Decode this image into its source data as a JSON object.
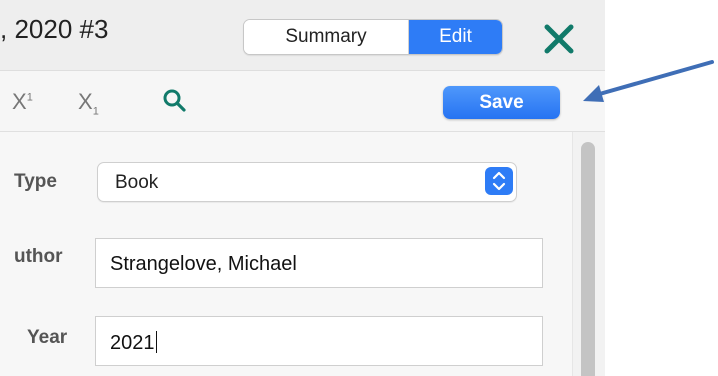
{
  "header": {
    "title": ", 2020 #3",
    "tabs": [
      {
        "label": "Summary",
        "selected": false
      },
      {
        "label": "Edit",
        "selected": true
      }
    ],
    "close_icon": "close-x-icon"
  },
  "toolbar": {
    "superscript": {
      "base": "X",
      "mark": "1"
    },
    "subscript": {
      "base": "X",
      "mark": "1"
    },
    "search_icon": "search-icon",
    "save_label": "Save"
  },
  "form": {
    "type": {
      "label": "Type",
      "value": "Book"
    },
    "author": {
      "label": "uthor",
      "value": "Strangelove, Michael"
    },
    "year": {
      "label": "Year",
      "value": "2021"
    }
  },
  "colors": {
    "accent": "#2e7cf6",
    "close": "#117a6a",
    "annotation_arrow": "#3f6eb6"
  }
}
